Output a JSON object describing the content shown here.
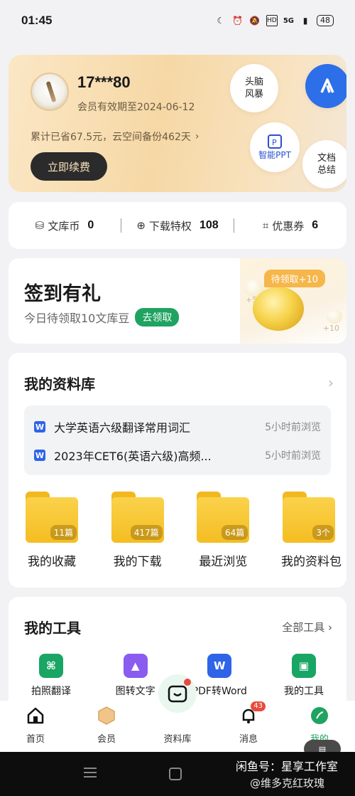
{
  "status": {
    "time": "01:45",
    "network": "5G",
    "battery": "48"
  },
  "member": {
    "username": "17***80",
    "expiry": "会员有效期至2024-06-12",
    "savings": "累计已省67.5元，云空间备份462天",
    "renew": "立即续费",
    "bubbles": {
      "brainstorm": "头脑\n风暴",
      "ppt": "智能PPT",
      "summary": "文档\n总结"
    }
  },
  "stats": {
    "coins_label": "文库币",
    "coins": "0",
    "download_label": "下载特权",
    "download": "108",
    "coupon_label": "优惠券",
    "coupon": "6"
  },
  "signin": {
    "title": "签到有礼",
    "subtitle": "今日待领取10文库豆",
    "claim": "去领取",
    "reward_tag": "待领取+10",
    "bean_left": "+5",
    "bean_right": "+10"
  },
  "library": {
    "title": "我的资料库",
    "recent": [
      {
        "title": "大学英语六级翻译常用词汇",
        "time": "5小时前浏览"
      },
      {
        "title": "2023年CET6(英语六级)高频...",
        "time": "5小时前浏览"
      }
    ],
    "folders": [
      {
        "label": "我的收藏",
        "count": "11篇"
      },
      {
        "label": "我的下载",
        "count": "417篇"
      },
      {
        "label": "最近浏览",
        "count": "64篇"
      },
      {
        "label": "我的资料包",
        "count": "3个"
      }
    ]
  },
  "tools": {
    "title": "我的工具",
    "all": "全部工具",
    "items": [
      {
        "label": "拍照翻译",
        "color": "#19a564"
      },
      {
        "label": "图转文字",
        "color": "#8a5cf0"
      },
      {
        "label": "PDF转Word",
        "color": "#2f63e8"
      },
      {
        "label": "我的工具",
        "color": "#19a564"
      }
    ]
  },
  "nav": {
    "items": [
      {
        "label": "首页"
      },
      {
        "label": "会员"
      },
      {
        "label": "资料库"
      },
      {
        "label": "消息",
        "badge": "43"
      },
      {
        "label": "我的"
      }
    ]
  },
  "watermark": {
    "line1": "闲鱼号：星享工作室",
    "line2": "@维多克红玫瑰"
  }
}
